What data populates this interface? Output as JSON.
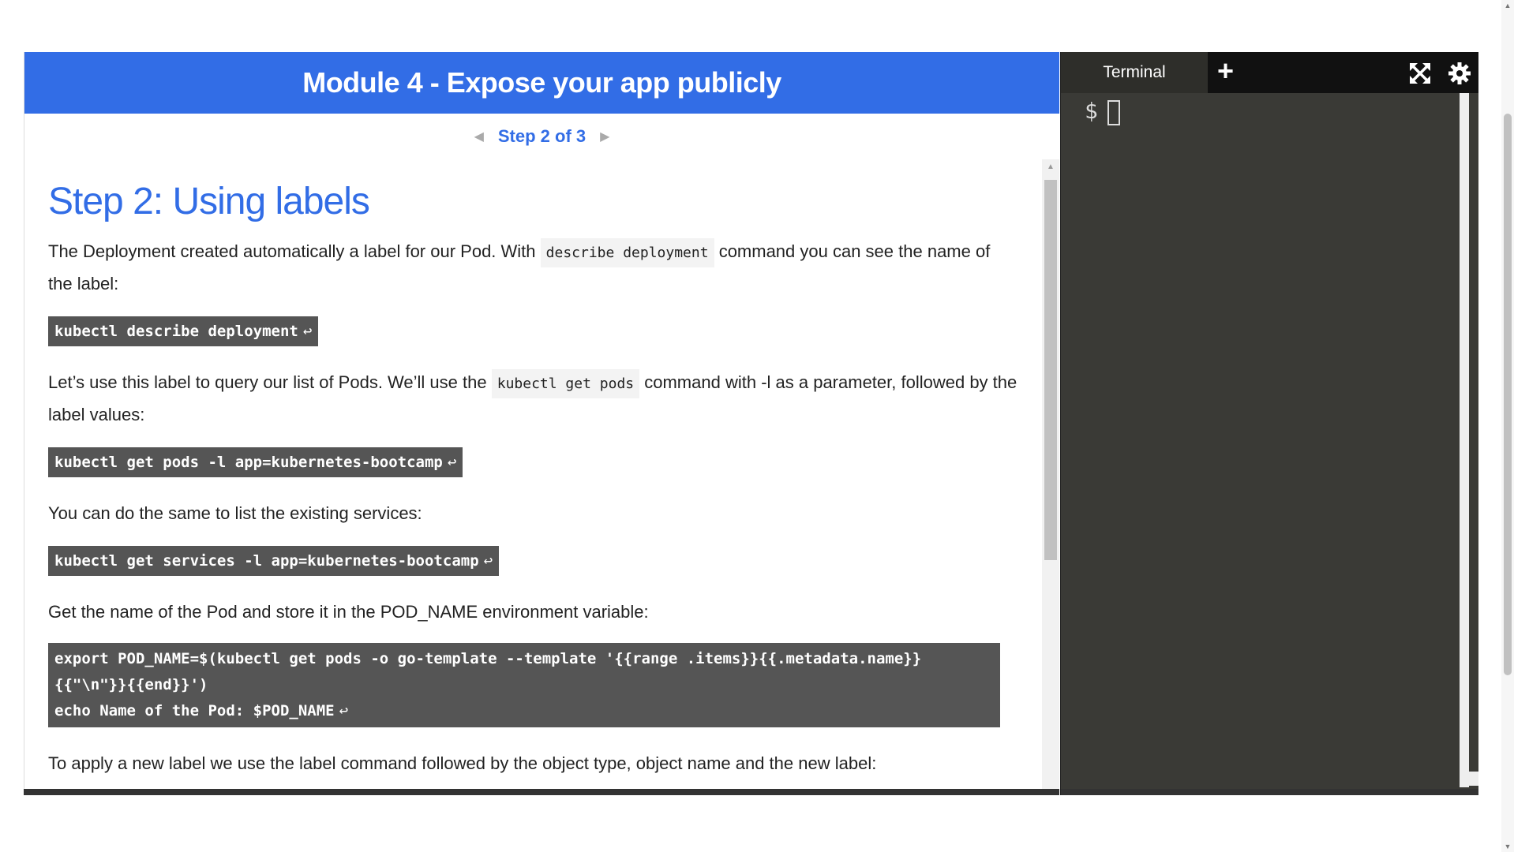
{
  "module": {
    "title": "Module 4 - Expose your app publicly"
  },
  "step_nav": {
    "label": "Step 2 of 3"
  },
  "content": {
    "heading": "Step 2: Using labels",
    "p1_a": "The Deployment created automatically a label for our Pod. With",
    "p1_code": "describe deployment",
    "p1_b": "command you can see the name of the label:",
    "cmd1": "kubectl describe deployment",
    "p2_a": "Let’s use this label to query our list of Pods. We’ll use the",
    "p2_code": "kubectl get pods",
    "p2_b": "command with -l as a parameter, followed by the label values:",
    "cmd2": "kubectl get pods -l app=kubernetes-bootcamp",
    "p3": "You can do the same to list the existing services:",
    "cmd3": "kubectl get services -l app=kubernetes-bootcamp",
    "p4": "Get the name of the Pod and store it in the POD_NAME environment variable:",
    "cmd4_line1": "export POD_NAME=$(kubectl get pods -o go-template --template '{{range .items}}{{.metadata.name}}",
    "cmd4_line2": "{{\"\\n\"}}{{end}}')",
    "cmd4_line3": "echo Name of the Pod: $POD_NAME",
    "p5": "To apply a new label we use the label command followed by the object type, object name and the new label:",
    "enter_symbol": "↩"
  },
  "terminal": {
    "tab_label": "Terminal",
    "add_label": "+",
    "prompt": "$",
    "icons": [
      "fullscreen-icon",
      "gear-icon"
    ]
  }
}
